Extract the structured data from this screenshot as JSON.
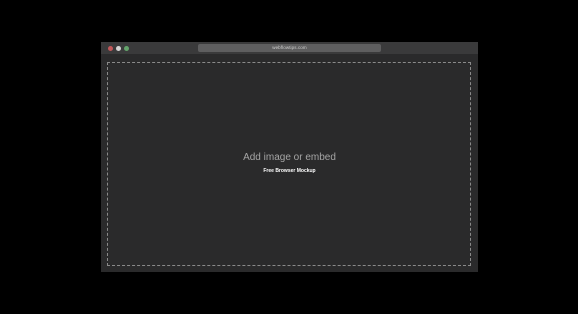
{
  "window": {
    "url": "webflowtips.com",
    "traffic_lights": {
      "close_color": "#c2585a",
      "minimize_color": "#d6d6d6",
      "maximize_color": "#63a46b"
    }
  },
  "content": {
    "placeholder_title": "Add image or embed",
    "placeholder_subtitle": "Free Browser Mockup"
  },
  "colors": {
    "page_background": "#000000",
    "window_background": "#2a2a2b",
    "titlebar_background": "#3a3a3b",
    "urlbar_background": "#5e5e5f",
    "dashed_border": "#8a8a8a"
  }
}
